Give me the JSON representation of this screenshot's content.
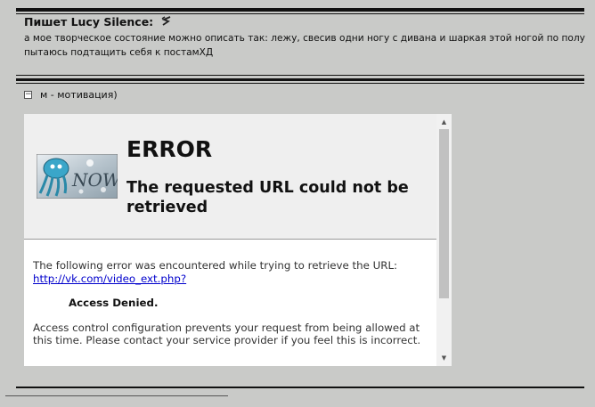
{
  "quote": {
    "author_line": "Пишет Lucy Silence:",
    "text": "а мое творческое состояние можно описать так: лежу, свесив одни ногу с дивана и шаркая этой ногой по полу пытаюсь подтащить себя к постамХД",
    "icon": "back-arrow-icon"
  },
  "spoiler": {
    "toggle": "−",
    "label": "м - мотивация)"
  },
  "error_page": {
    "logo_text": "NOW",
    "title": "ERROR",
    "subtitle": "The requested URL could not be retrieved",
    "intro": "The following error was encountered while trying to retrieve the URL:",
    "url": "http://vk.com/video_ext.php?",
    "denied": "Access Denied.",
    "description": "Access control configuration prevents your request from being allowed at this time. Please contact your service provider if you feel this is incorrect."
  },
  "scrollbar": {
    "up_arrow": "▲",
    "down_arrow": "▼"
  },
  "colors": {
    "page_bg": "#c9cac8",
    "link": "#0000cc",
    "header_bg": "#efefef"
  }
}
